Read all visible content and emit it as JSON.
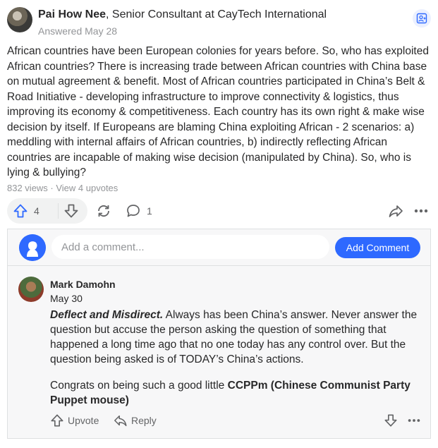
{
  "answer": {
    "author_name": "Pai How Nee",
    "author_credential": ", Senior Consultant at CayTech International",
    "answered_date": "Answered May 28",
    "text": "African countries have been European colonies for years before. So, who has exploited African countries? There is increasing trade between African countries with China base on mutual agreement & benefit. Most of African countries participated in China’s Belt & Road Initiative - developing infrastructure to improve connectivity & logistics, thus improving its economy & competitiveness. Each country has its own right & make wise decision by itself. If Europeans are blaming China exploiting African - 2 scenarios: a) meddling with internal affairs of African countries, b) indirectly reflecting African countries are incapable of making wise decision (manipulated by China). So, who is lying & bullying?",
    "stats": "832 views · View 4 upvotes",
    "upvote_count": "4",
    "comment_count": "1"
  },
  "icons": {
    "follow": "follow-person-icon",
    "upvote": "arrow-up-icon",
    "downvote": "arrow-down-icon",
    "share": "reshare-icon",
    "comment": "comment-bubble-icon",
    "forward": "share-arrow-icon",
    "more": "more-dots-icon"
  },
  "compose": {
    "placeholder": "Add a comment...",
    "button_label": "Add Comment"
  },
  "comment": {
    "author": "Mark Damohn",
    "date": "May 30",
    "lead": "Deflect and Misdirect.",
    "para1_rest": " Always has been China’s answer. Never answer the question but accuse the person asking the question of something that happened a long time ago that no one today has any control over. But the question being asked is of TODAY’s China’s actions.",
    "para2_start": "Congrats on being such a good little ",
    "para2_bold": "CCPPm (Chinese Communist Party Puppet mouse)",
    "upvote_label": "Upvote",
    "reply_label": "Reply"
  },
  "colors": {
    "accent": "#2e69ff",
    "text": "#282829",
    "muted": "#939598",
    "icon": "#636466",
    "panel_bg": "#f7f7f8",
    "border": "#dee0e1"
  }
}
